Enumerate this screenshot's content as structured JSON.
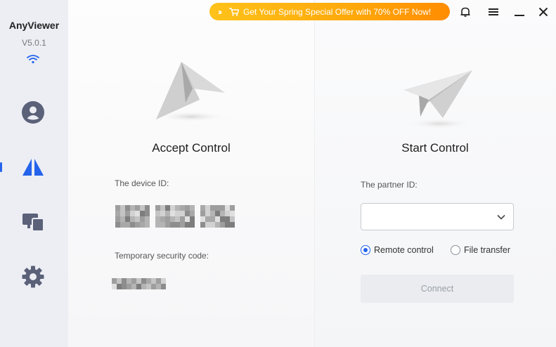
{
  "app": {
    "name": "AnyViewer",
    "version": "V5.0.1"
  },
  "promo": {
    "text": "Get Your Spring Special Offer with 70% OFF Now!",
    "color": "#ffb10f"
  },
  "sidebar": {
    "items": [
      {
        "name": "account",
        "icon": "user-icon",
        "active": false
      },
      {
        "name": "control",
        "icon": "anyviewer-logo-icon",
        "active": true
      },
      {
        "name": "devices",
        "icon": "devices-icon",
        "active": false
      },
      {
        "name": "settings",
        "icon": "gear-icon",
        "active": false
      }
    ]
  },
  "accept": {
    "title": "Accept Control",
    "device_id_label": "The device ID:",
    "security_label": "Temporary security code:"
  },
  "start": {
    "title": "Start Control",
    "partner_label": "The partner ID:",
    "partner_value": "",
    "mode_remote": "Remote control",
    "mode_file": "File transfer",
    "selected_mode": "Remote control",
    "connect_label": "Connect"
  },
  "colors": {
    "accent": "#2563eb",
    "icon_gray": "#5a6178",
    "sidebar_bg": "#eceef4"
  }
}
